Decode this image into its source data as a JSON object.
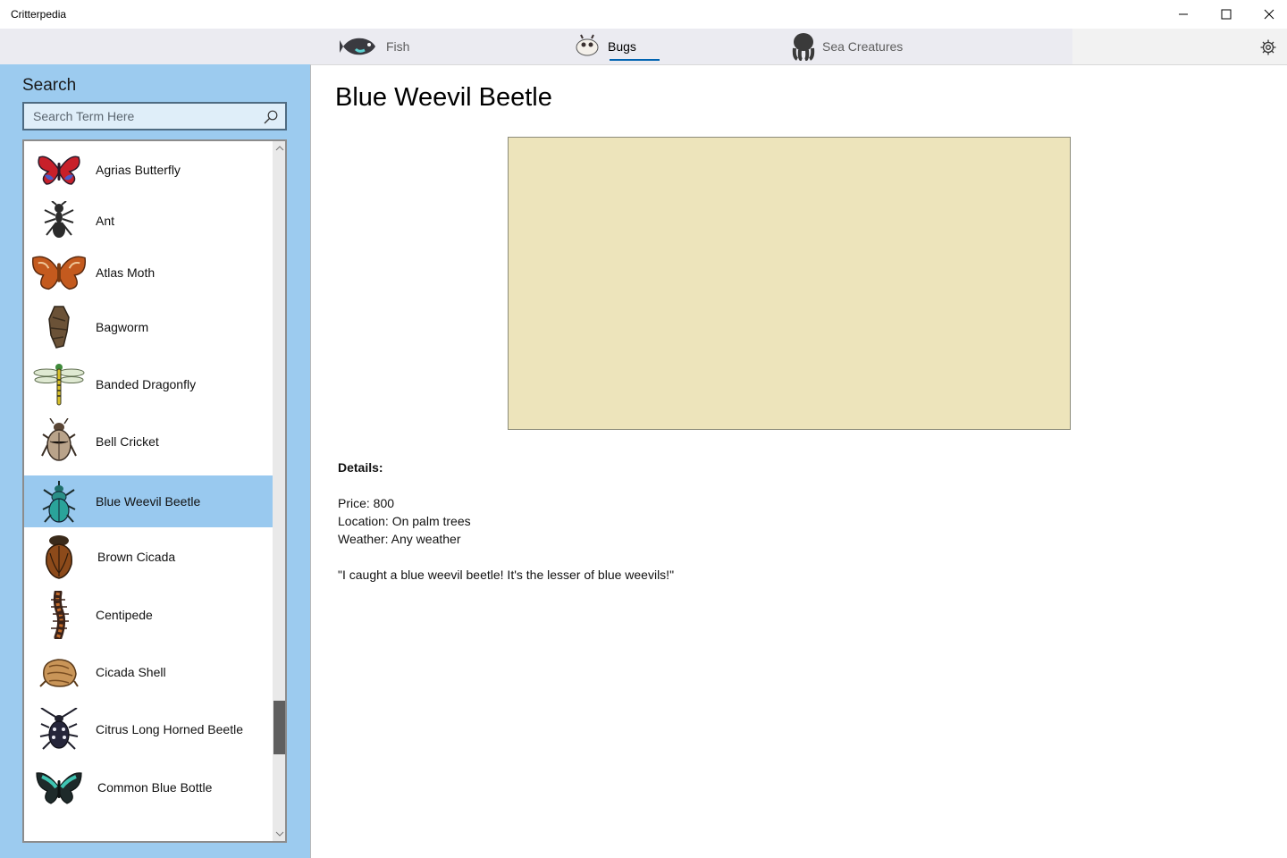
{
  "app": {
    "title": "Critterpedia"
  },
  "window_controls": {
    "minimize_icon": "minimize-icon",
    "maximize_icon": "maximize-icon",
    "close_icon": "close-icon"
  },
  "nav": {
    "tabs": [
      {
        "label": "Fish",
        "icon": "fish-icon",
        "active": false
      },
      {
        "label": "Bugs",
        "icon": "bug-icon",
        "active": true
      },
      {
        "label": "Sea Creatures",
        "icon": "octopus-icon",
        "active": false
      }
    ],
    "settings_icon": "gear-icon",
    "accent": "#0063b1"
  },
  "sidebar": {
    "heading": "Search",
    "search": {
      "placeholder": "Search Term Here",
      "value": ""
    },
    "items": [
      {
        "label": "Agrias Butterfly",
        "icon": "butterfly-icon"
      },
      {
        "label": "Ant",
        "icon": "ant-icon"
      },
      {
        "label": "Atlas Moth",
        "icon": "moth-icon"
      },
      {
        "label": "Bagworm",
        "icon": "bagworm-icon"
      },
      {
        "label": "Banded Dragonfly",
        "icon": "dragonfly-icon"
      },
      {
        "label": "Bell Cricket",
        "icon": "cricket-icon"
      },
      {
        "label": "Blue Weevil Beetle",
        "icon": "beetle-icon",
        "selected": true
      },
      {
        "label": "Brown Cicada",
        "icon": "cicada-icon"
      },
      {
        "label": "Centipede",
        "icon": "centipede-icon"
      },
      {
        "label": "Cicada Shell",
        "icon": "shell-icon"
      },
      {
        "label": "Citrus Long Horned Beetle",
        "icon": "longhorn-beetle-icon"
      },
      {
        "label": "Common Blue Bottle",
        "icon": "butterfly-icon"
      }
    ],
    "colors": {
      "background": "#9ccbef",
      "selected": "#99c9ef"
    }
  },
  "detail": {
    "title": "Blue Weevil Beetle",
    "details_heading": "Details:",
    "price": "Price: 800",
    "location": "Location: On palm trees",
    "weather": "Weather: Any weather",
    "quote": "\"I caught a blue weevil beetle! It's the lesser of blue weevils!\"",
    "image_placeholder_color": "#ede4bb"
  }
}
